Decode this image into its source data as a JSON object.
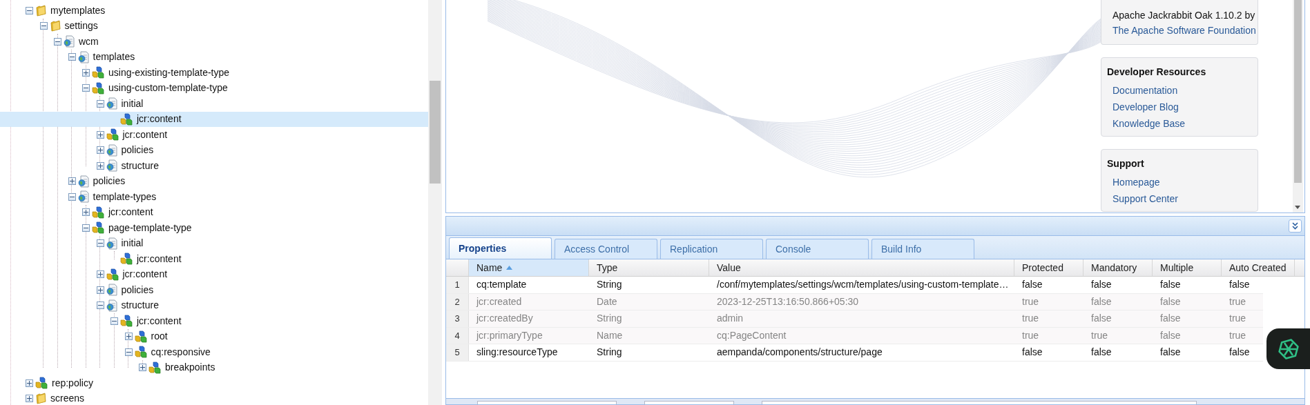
{
  "tree": [
    {
      "label": "mytemplates",
      "kind": "folder",
      "leaf": false,
      "expanded": true,
      "selected": false,
      "children": [
        {
          "label": "settings",
          "kind": "folder",
          "leaf": false,
          "expanded": true,
          "selected": false,
          "children": [
            {
              "label": "wcm",
              "kind": "page",
              "leaf": false,
              "expanded": true,
              "selected": false,
              "children": [
                {
                  "label": "templates",
                  "kind": "page",
                  "leaf": false,
                  "expanded": true,
                  "selected": false,
                  "children": [
                    {
                      "label": "using-existing-template-type",
                      "kind": "node",
                      "leaf": false,
                      "expanded": false,
                      "selected": false
                    },
                    {
                      "label": "using-custom-template-type",
                      "kind": "node",
                      "leaf": false,
                      "expanded": true,
                      "selected": false,
                      "children": [
                        {
                          "label": "initial",
                          "kind": "page",
                          "leaf": false,
                          "expanded": true,
                          "selected": false,
                          "children": [
                            {
                              "label": "jcr:content",
                              "kind": "node",
                              "leaf": true,
                              "expanded": false,
                              "selected": true
                            }
                          ]
                        },
                        {
                          "label": "jcr:content",
                          "kind": "node",
                          "leaf": false,
                          "expanded": false,
                          "selected": false
                        },
                        {
                          "label": "policies",
                          "kind": "page",
                          "leaf": false,
                          "expanded": false,
                          "selected": false
                        },
                        {
                          "label": "structure",
                          "kind": "page",
                          "leaf": false,
                          "expanded": false,
                          "selected": false
                        }
                      ]
                    }
                  ]
                },
                {
                  "label": "policies",
                  "kind": "page",
                  "leaf": false,
                  "expanded": false,
                  "selected": false
                },
                {
                  "label": "template-types",
                  "kind": "page",
                  "leaf": false,
                  "expanded": true,
                  "selected": false,
                  "children": [
                    {
                      "label": "jcr:content",
                      "kind": "node",
                      "leaf": false,
                      "expanded": false,
                      "selected": false
                    },
                    {
                      "label": "page-template-type",
                      "kind": "node",
                      "leaf": false,
                      "expanded": true,
                      "selected": false,
                      "children": [
                        {
                          "label": "initial",
                          "kind": "page",
                          "leaf": false,
                          "expanded": true,
                          "selected": false,
                          "children": [
                            {
                              "label": "jcr:content",
                              "kind": "node",
                              "leaf": true,
                              "expanded": false,
                              "selected": false
                            }
                          ]
                        },
                        {
                          "label": "jcr:content",
                          "kind": "node",
                          "leaf": false,
                          "expanded": false,
                          "selected": false
                        },
                        {
                          "label": "policies",
                          "kind": "page",
                          "leaf": false,
                          "expanded": false,
                          "selected": false
                        },
                        {
                          "label": "structure",
                          "kind": "page",
                          "leaf": false,
                          "expanded": true,
                          "selected": false,
                          "children": [
                            {
                              "label": "jcr:content",
                              "kind": "node",
                              "leaf": false,
                              "expanded": true,
                              "selected": false,
                              "children": [
                                {
                                  "label": "root",
                                  "kind": "node",
                                  "leaf": false,
                                  "expanded": false,
                                  "selected": false
                                },
                                {
                                  "label": "cq:responsive",
                                  "kind": "node",
                                  "leaf": false,
                                  "expanded": true,
                                  "selected": false,
                                  "children": [
                                    {
                                      "label": "breakpoints",
                                      "kind": "node",
                                      "leaf": false,
                                      "expanded": false,
                                      "selected": false
                                    }
                                  ]
                                }
                              ]
                            }
                          ]
                        }
                      ]
                    }
                  ]
                }
              ]
            }
          ]
        }
      ]
    },
    {
      "label": "rep:policy",
      "kind": "node",
      "leaf": false,
      "expanded": false,
      "selected": false
    },
    {
      "label": "screens",
      "kind": "folder",
      "leaf": false,
      "expanded": false,
      "selected": false
    }
  ],
  "info_panels": [
    {
      "lines": [
        {
          "text": "Apache Jackrabbit Oak 1.10.2 by",
          "kind": "text"
        },
        {
          "text": "The Apache Software Foundation",
          "kind": "link"
        }
      ]
    },
    {
      "title": "Developer Resources",
      "lines": [
        {
          "text": "Documentation",
          "kind": "link"
        },
        {
          "text": "Developer Blog",
          "kind": "link"
        },
        {
          "text": "Knowledge Base",
          "kind": "link"
        }
      ]
    },
    {
      "title": "Support",
      "lines": [
        {
          "text": "Homepage",
          "kind": "link"
        },
        {
          "text": "Support Center",
          "kind": "link"
        }
      ]
    }
  ],
  "tabs": [
    {
      "label": "Properties",
      "selected": true
    },
    {
      "label": "Access Control",
      "selected": false
    },
    {
      "label": "Replication",
      "selected": false
    },
    {
      "label": "Console",
      "selected": false
    },
    {
      "label": "Build Info",
      "selected": false
    }
  ],
  "table": {
    "columns": [
      {
        "label": "Name",
        "sorted": true
      },
      {
        "label": "Type",
        "sorted": false
      },
      {
        "label": "Value",
        "sorted": false
      },
      {
        "label": "Protected",
        "sorted": false
      },
      {
        "label": "Mandatory",
        "sorted": false
      },
      {
        "label": "Multiple",
        "sorted": false
      },
      {
        "label": "Auto Created",
        "sorted": false
      }
    ],
    "rows": [
      {
        "index": "1",
        "disabled": false,
        "cells": [
          "cq:template",
          "String",
          "/conf/mytemplates/settings/wcm/templates/using-custom-template…",
          "false",
          "false",
          "false",
          "false"
        ]
      },
      {
        "index": "2",
        "disabled": true,
        "cells": [
          "jcr:created",
          "Date",
          "2023-12-25T13:16:50.866+05:30",
          "true",
          "false",
          "false",
          "true"
        ]
      },
      {
        "index": "3",
        "disabled": true,
        "cells": [
          "jcr:createdBy",
          "String",
          "admin",
          "true",
          "false",
          "false",
          "true"
        ]
      },
      {
        "index": "4",
        "disabled": true,
        "cells": [
          "jcr:primaryType",
          "Name",
          "cq:PageContent",
          "true",
          "true",
          "false",
          "true"
        ]
      },
      {
        "index": "5",
        "disabled": false,
        "cells": [
          "sling:resourceType",
          "String",
          "aempanda/components/structure/page",
          "false",
          "false",
          "false",
          "false"
        ]
      }
    ]
  }
}
